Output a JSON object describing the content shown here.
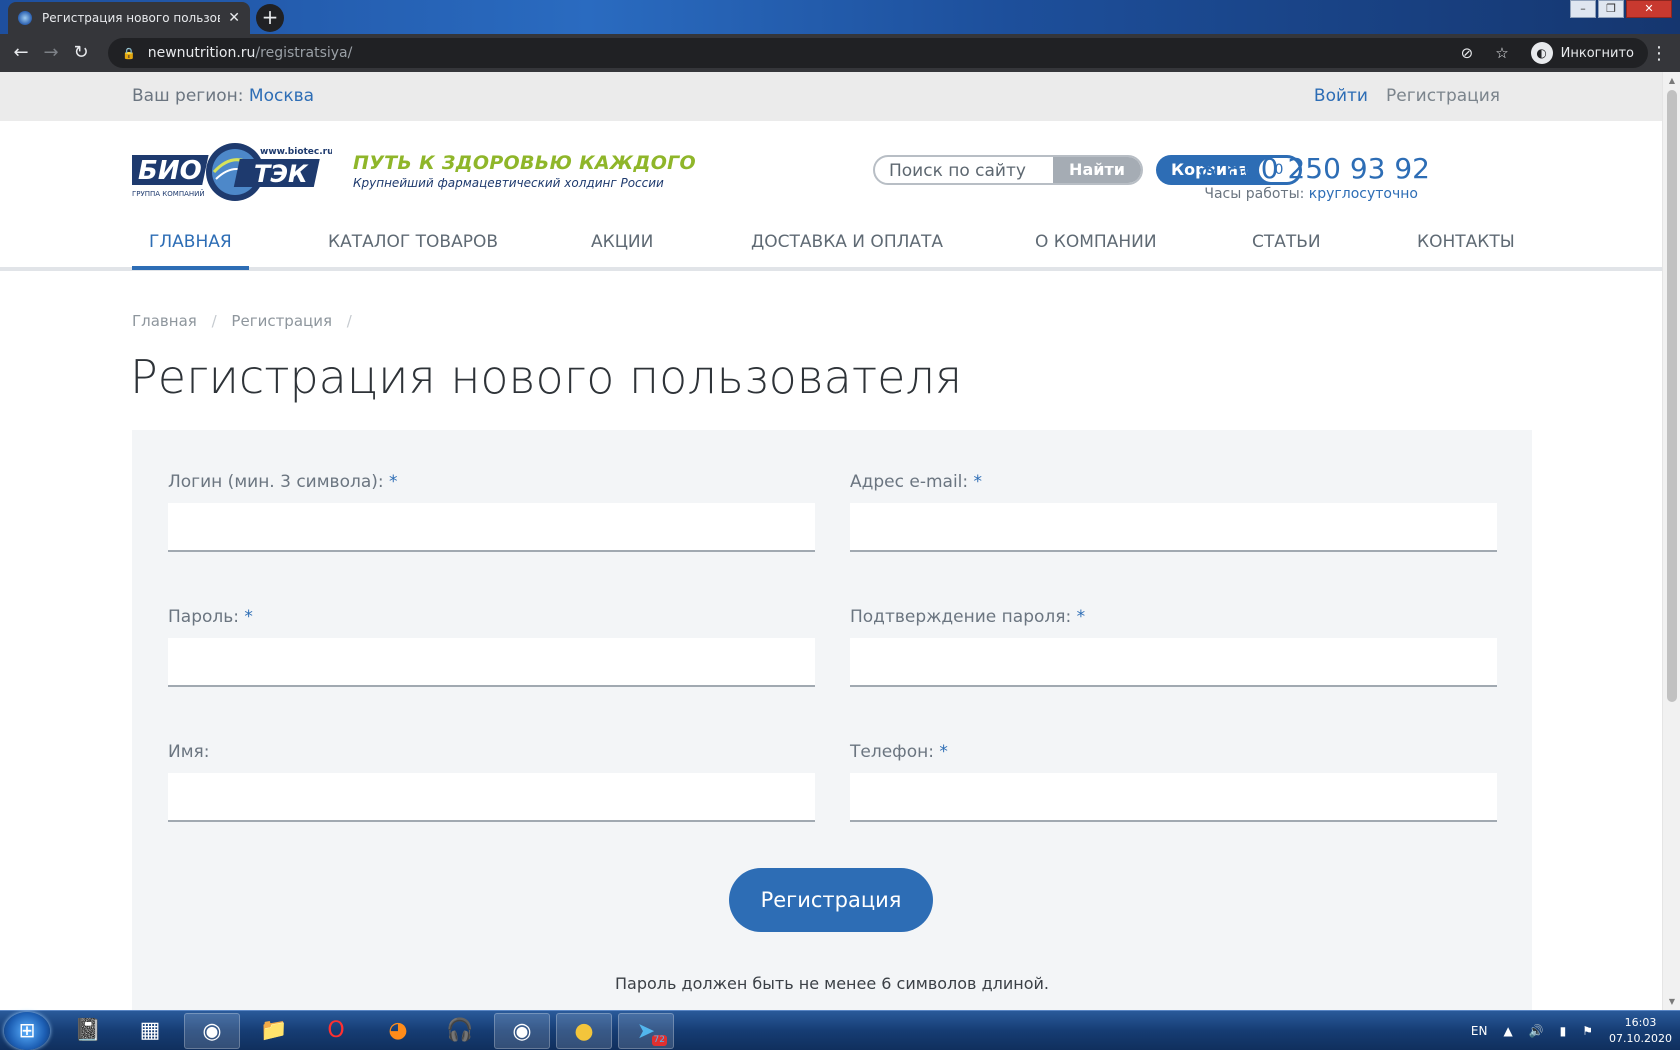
{
  "browser": {
    "tab_title": "Регистрация нового пользовате",
    "tab_close": "✕",
    "new_tab": "+",
    "url_host": "newnutrition.ru",
    "url_path": "/registratsiya/",
    "profile_label": "Инкогнито",
    "icons": [
      "back-icon",
      "forward-icon",
      "reload-icon",
      "lock-icon",
      "eye-off-icon",
      "star-icon",
      "incognito-icon",
      "menu-icon"
    ]
  },
  "topbar": {
    "region_label": "Ваш регион:",
    "region_value": "Москва",
    "login": "Войти",
    "register": "Регистрация"
  },
  "header": {
    "logo_text_1": "БИО",
    "logo_text_2": "ТЭК",
    "logo_url": "www.biotec.ru",
    "logo_caption": "ГРУППА КОМПАНИЙ",
    "slogan": "ПУТЬ К ЗДОРОВЬЮ КАЖДОГО",
    "subslogan": "Крупнейший фармацевтический холдинг России",
    "search_placeholder": "Поиск по сайту",
    "search_button": "Найти",
    "cart_label": "Корзина",
    "cart_count": "0",
    "phone": "8 800 250 93 92",
    "hours_label": "Часы работы:",
    "hours_value": "круглосуточно"
  },
  "nav": {
    "items": [
      "ГЛАВНАЯ",
      "КАТАЛОГ ТОВАРОВ",
      "АКЦИИ",
      "ДОСТАВКА И ОПЛАТА",
      "О КОМПАНИИ",
      "СТАТЬИ",
      "КОНТАКТЫ"
    ],
    "active": "ГЛАВНАЯ"
  },
  "breadcrumb": {
    "items": [
      "Главная",
      "Регистрация"
    ],
    "separator": "/"
  },
  "page": {
    "title": "Регистрация нового пользователя"
  },
  "form": {
    "required_mark": "*",
    "fields": {
      "login": {
        "label": "Логин (мин. 3 символа):",
        "value": ""
      },
      "email": {
        "label": "Адрес e-mail:",
        "value": ""
      },
      "password": {
        "label": "Пароль:",
        "value": ""
      },
      "confirm": {
        "label": "Подтверждение пароля:",
        "value": ""
      },
      "name": {
        "label": "Имя:",
        "value": ""
      },
      "phone": {
        "label": "Телефон:",
        "value": ""
      }
    },
    "submit": "Регистрация",
    "note": "Пароль должен быть не менее 6 символов длиной."
  },
  "taskbar": {
    "apps": [
      "notepad-icon",
      "calculator-icon",
      "chrome-icon",
      "explorer-icon",
      "opera-icon",
      "firefox-icon",
      "headset-icon",
      "chrome-incognito-icon",
      "chromium-icon",
      "telegram-icon"
    ],
    "telegram_badge": "72",
    "lang": "EN",
    "time": "16:03",
    "date": "07.10.2020"
  },
  "colors": {
    "accent": "#2d6db5",
    "slogan_green": "#8fb62a",
    "form_bg": "#f3f5f7",
    "topstrip_bg": "#ebebeb"
  }
}
